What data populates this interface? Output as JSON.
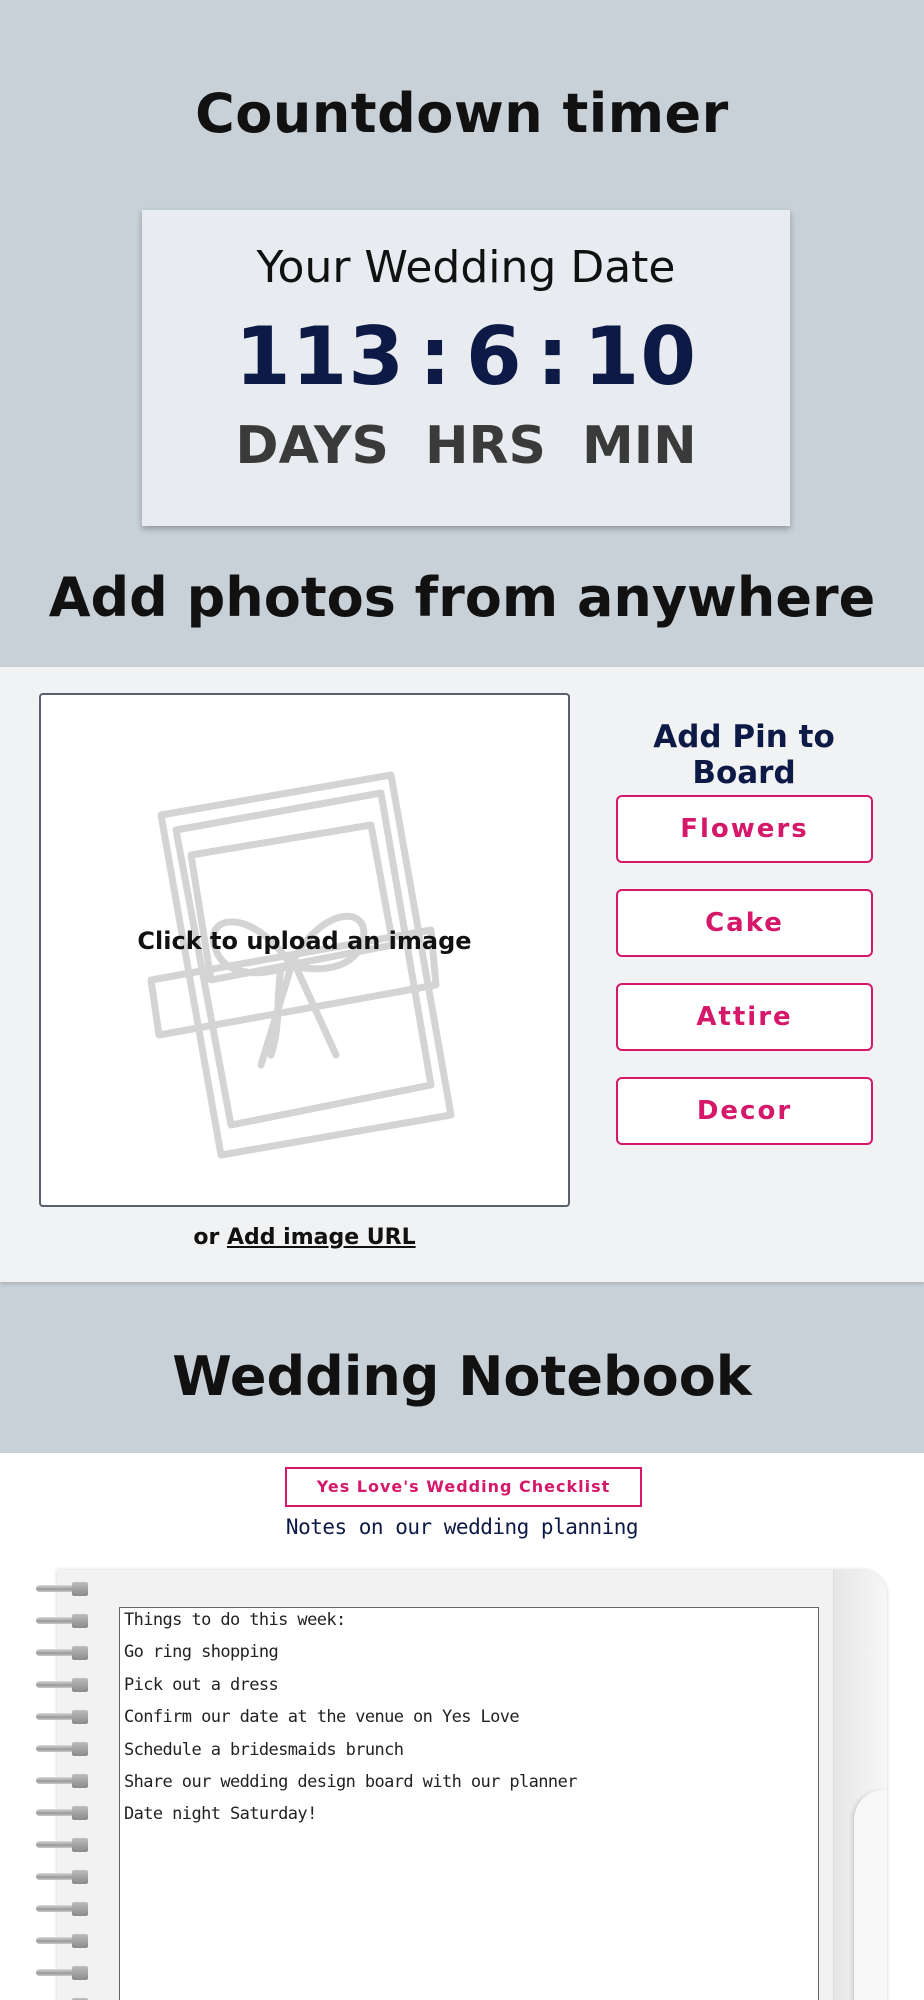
{
  "sections": {
    "countdown_title": "Countdown timer",
    "photos_title": "Add photos from anywhere",
    "notebook_title": "Wedding Notebook"
  },
  "countdown": {
    "label": "Your Wedding Date",
    "days": "113",
    "hours": "6",
    "minutes": "10",
    "separator": ":",
    "days_unit": "DAYS",
    "hours_unit": "HRS",
    "minutes_unit": "MIN"
  },
  "upload": {
    "prompt": "Click to upload an image",
    "or_text": "or",
    "url_link": "Add image URL",
    "illustration_icon": "gift-photo-icon"
  },
  "pin": {
    "title": "Add Pin to Board",
    "boards": [
      "Flowers",
      "Cake",
      "Attire",
      "Decor"
    ]
  },
  "notebook": {
    "checklist_button": "Yes Love's Wedding Checklist",
    "subtitle": "Notes on our wedding planning",
    "lines": [
      "Things to do this week:",
      "Go ring shopping",
      "Pick out a dress",
      "Confirm our date at the venue on Yes Love",
      "Schedule a bridesmaids brunch",
      "Share our wedding design board with our planner",
      "Date night Saturday!"
    ]
  },
  "colors": {
    "background": "#c8d1d8",
    "accent": "#d6186a",
    "navy": "#0c1a45"
  }
}
